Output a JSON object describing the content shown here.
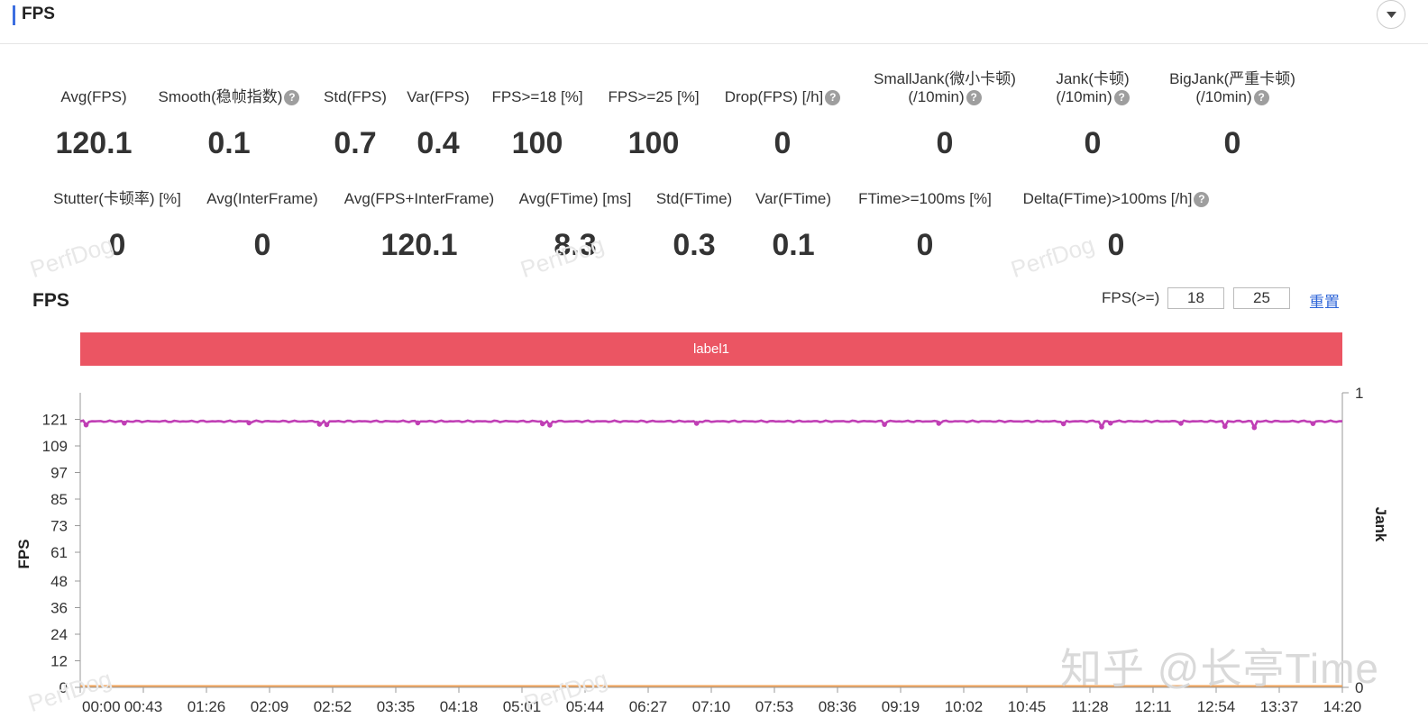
{
  "header": {
    "title": "FPS"
  },
  "metrics_row1": [
    {
      "label": "Avg(FPS)",
      "value": "120.1",
      "help": false
    },
    {
      "label": "Smooth(稳帧指数)",
      "value": "0.1",
      "help": true
    },
    {
      "label": "Std(FPS)",
      "value": "0.7",
      "help": false
    },
    {
      "label": "Var(FPS)",
      "value": "0.4",
      "help": false
    },
    {
      "label": "FPS>=18 [%]",
      "value": "100",
      "help": false
    },
    {
      "label": "FPS>=25 [%]",
      "value": "100",
      "help": false
    },
    {
      "label": "Drop(FPS) [/h]",
      "value": "0",
      "help": true
    },
    {
      "label": "SmallJank(微小卡顿)",
      "label2": "(/10min)",
      "value": "0",
      "help": true
    },
    {
      "label": "Jank(卡顿)",
      "label2": "(/10min)",
      "value": "0",
      "help": true
    },
    {
      "label": "BigJank(严重卡顿)",
      "label2": "(/10min)",
      "value": "0",
      "help": true
    }
  ],
  "metrics_row2": [
    {
      "label": "Stutter(卡顿率) [%]",
      "value": "0",
      "help": false
    },
    {
      "label": "Avg(InterFrame)",
      "value": "0",
      "help": false
    },
    {
      "label": "Avg(FPS+InterFrame)",
      "value": "120.1",
      "help": false
    },
    {
      "label": "Avg(FTime) [ms]",
      "value": "8.3",
      "help": false
    },
    {
      "label": "Std(FTime)",
      "value": "0.3",
      "help": false
    },
    {
      "label": "Var(FTime)",
      "value": "0.1",
      "help": false
    },
    {
      "label": "FTime>=100ms [%]",
      "value": "0",
      "help": false
    },
    {
      "label": "Delta(FTime)>100ms [/h]",
      "value": "0",
      "help": true
    }
  ],
  "chart_section": {
    "title": "FPS",
    "threshold_label": "FPS(>=)",
    "threshold_values": [
      "18",
      "25"
    ],
    "reset_label": "重置",
    "label_bar": "label1"
  },
  "watermarks": [
    "PerfDog",
    "知乎 @长亭Time"
  ],
  "colors": {
    "accent": "#3d6ee0",
    "label_bar": "#eb5563",
    "fps_series": "#c03fb5",
    "jank_series": "#f0a35a",
    "link": "#2f66d8"
  },
  "chart_data": {
    "type": "line",
    "ylabel": "FPS",
    "y2label": "Jank",
    "yticks": [
      0,
      12,
      24,
      36,
      48,
      61,
      73,
      85,
      97,
      109,
      121
    ],
    "y2ticks": [
      0,
      1
    ],
    "ylim": [
      0,
      133
    ],
    "y2lim": [
      0,
      1
    ],
    "xticks": [
      "00:00",
      "00:43",
      "01:26",
      "02:09",
      "02:52",
      "03:35",
      "04:18",
      "05:01",
      "05:44",
      "06:27",
      "07:10",
      "07:53",
      "08:36",
      "09:19",
      "10:02",
      "10:45",
      "11:28",
      "12:11",
      "12:54",
      "13:37",
      "14:20"
    ],
    "xlim_seconds": [
      0,
      860
    ],
    "series": [
      {
        "name": "",
        "axis": "left",
        "baseline": 120.1,
        "dips": [
          {
            "t": 4,
            "v": 118.5
          },
          {
            "t": 30,
            "v": 119.3
          },
          {
            "t": 115,
            "v": 119.4
          },
          {
            "t": 163,
            "v": 118.8
          },
          {
            "t": 168,
            "v": 118.6
          },
          {
            "t": 230,
            "v": 119.4
          },
          {
            "t": 315,
            "v": 119.0
          },
          {
            "t": 320,
            "v": 118.4
          },
          {
            "t": 420,
            "v": 119.2
          },
          {
            "t": 548,
            "v": 118.7
          },
          {
            "t": 585,
            "v": 119.2
          },
          {
            "t": 670,
            "v": 119.0
          },
          {
            "t": 696,
            "v": 117.6
          },
          {
            "t": 702,
            "v": 119.3
          },
          {
            "t": 750,
            "v": 119.2
          },
          {
            "t": 780,
            "v": 117.8
          },
          {
            "t": 800,
            "v": 117.3
          },
          {
            "t": 840,
            "v": 119.1
          }
        ]
      },
      {
        "name": "",
        "axis": "right",
        "values_constant": 0
      }
    ]
  }
}
